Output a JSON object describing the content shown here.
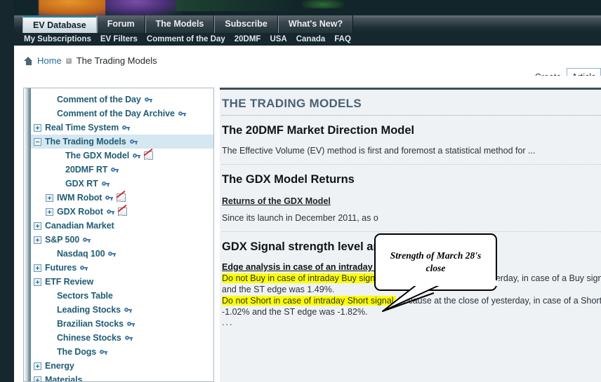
{
  "header": {
    "tabs": [
      {
        "label": "EV Database",
        "active": true
      },
      {
        "label": "Forum",
        "active": false
      },
      {
        "label": "The Models",
        "active": false
      },
      {
        "label": "Subscribe",
        "active": false
      },
      {
        "label": "What's New?",
        "active": false
      }
    ],
    "subnav": [
      "My Subscriptions",
      "EV Filters",
      "Comment of the Day",
      "20DMF",
      "USA",
      "Canada",
      "FAQ"
    ]
  },
  "breadcrumb": {
    "home_icon": "home-icon",
    "home": "Home",
    "separator_icon": "bullet-separator-icon",
    "current": "The Trading Models"
  },
  "toolbar": {
    "create_label": "Create",
    "article_value": "Article"
  },
  "sidebar": {
    "items": [
      {
        "label": "Comment of the Day",
        "indent": 1,
        "toggle": "none",
        "key": true,
        "chart": false,
        "selected": false
      },
      {
        "label": "Comment of the Day Archive",
        "indent": 1,
        "toggle": "none",
        "key": true,
        "chart": false,
        "selected": false
      },
      {
        "label": "Real Time System",
        "indent": 0,
        "toggle": "plus",
        "key": true,
        "chart": false,
        "selected": false
      },
      {
        "label": "The Trading Models",
        "indent": 0,
        "toggle": "minus",
        "key": true,
        "chart": false,
        "selected": true
      },
      {
        "label": "The GDX Model",
        "indent": 2,
        "toggle": "none",
        "key": true,
        "chart": true,
        "selected": false
      },
      {
        "label": "20DMF RT",
        "indent": 2,
        "toggle": "none",
        "key": true,
        "chart": false,
        "selected": false
      },
      {
        "label": "GDX RT",
        "indent": 2,
        "toggle": "none",
        "key": true,
        "chart": false,
        "selected": false
      },
      {
        "label": "IWM Robot",
        "indent": 1,
        "toggle": "plus",
        "key": true,
        "chart": true,
        "selected": false
      },
      {
        "label": "GDX Robot",
        "indent": 1,
        "toggle": "plus",
        "key": true,
        "chart": true,
        "selected": false
      },
      {
        "label": "Canadian Market",
        "indent": 0,
        "toggle": "plus",
        "key": false,
        "chart": false,
        "selected": false
      },
      {
        "label": "S&P 500",
        "indent": 0,
        "toggle": "plus",
        "key": true,
        "chart": false,
        "selected": false
      },
      {
        "label": "Nasdaq 100",
        "indent": 1,
        "toggle": "none",
        "key": true,
        "chart": false,
        "selected": false
      },
      {
        "label": "Futures",
        "indent": 0,
        "toggle": "plus",
        "key": true,
        "chart": false,
        "selected": false
      },
      {
        "label": "ETF Review",
        "indent": 0,
        "toggle": "plus",
        "key": false,
        "chart": false,
        "selected": false
      },
      {
        "label": "Sectors Table",
        "indent": 1,
        "toggle": "none",
        "key": false,
        "chart": false,
        "selected": false
      },
      {
        "label": "Leading Stocks",
        "indent": 1,
        "toggle": "none",
        "key": true,
        "chart": false,
        "selected": false
      },
      {
        "label": "Brazilian Stocks",
        "indent": 1,
        "toggle": "none",
        "key": true,
        "chart": false,
        "selected": false
      },
      {
        "label": "Chinese Stocks",
        "indent": 1,
        "toggle": "none",
        "key": true,
        "chart": false,
        "selected": false
      },
      {
        "label": "The Dogs",
        "indent": 1,
        "toggle": "none",
        "key": true,
        "chart": false,
        "selected": false
      },
      {
        "label": "Energy",
        "indent": 0,
        "toggle": "plus",
        "key": false,
        "chart": false,
        "selected": false
      },
      {
        "label": "Materials",
        "indent": 0,
        "toggle": "plus",
        "key": false,
        "chart": false,
        "selected": false
      }
    ]
  },
  "main": {
    "section_title": "THE TRADING MODELS",
    "block1": {
      "heading": "The 20DMF Market Direction Model",
      "paragraph": "The Effective Volume (EV) method is first and foremost a statistical method for ..."
    },
    "block2": {
      "heading": "The GDX Model Returns",
      "link": "Returns of the GDX Model",
      "paragraph": "Since its launch in December 2011, as o"
    },
    "block3": {
      "heading": "GDX Signal strength level and last updates",
      "edge_heading": "Edge analysis in case of an intraday real time GDX MF change",
      "line1_highlight": "Do not Buy in case of intraday Buy signal,",
      "line1_rest": " because at the close of yesterday, in case of a Buy signal",
      "line2": "and the ST edge was 1.49%.",
      "line3_highlight": "Do not Short in case of intraday Short signal,",
      "line3_rest": " because at the close of yesterday, in case of a Short",
      "line4": "-1.02% and the ST edge was -1.82%.",
      "ellipsis": "..."
    }
  },
  "callout": {
    "text": "Strength of March 28's close"
  },
  "colors": {
    "accent_teal": "#2f7f96",
    "nav_dark": "#16272e",
    "link_blue": "#215d76",
    "highlight_yellow": "#ffff00",
    "content_bg": "#eef2f5",
    "selected_row": "#d5e7f0"
  }
}
